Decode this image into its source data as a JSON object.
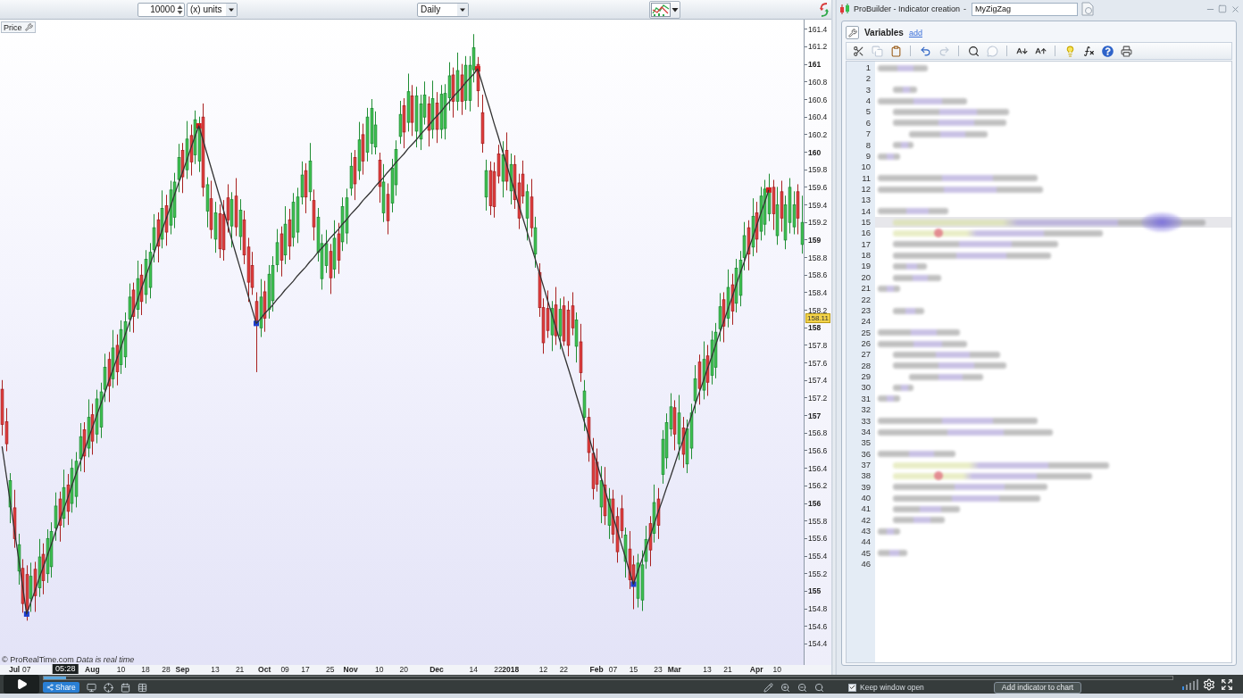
{
  "chart_window": {
    "toolbar": {
      "quantity": "10000",
      "unit": "(x) units",
      "timeframe": "Daily"
    },
    "chart": {
      "label": "Price",
      "footer": "© ProRealTime.com *Data is real time*",
      "chart_data": {
        "type": "candlestick",
        "ylim": [
          154.16,
          161.51
        ],
        "yticks": [
          {
            "value": 161.4,
            "label": "161.4"
          },
          {
            "value": 161.2,
            "label": "161.2"
          },
          {
            "value": 161,
            "label": "161"
          },
          {
            "value": 160.8,
            "label": "160.8"
          },
          {
            "value": 160.6,
            "label": "160.6"
          },
          {
            "value": 160.4,
            "label": "160.4"
          },
          {
            "value": 160.2,
            "label": "160.2"
          },
          {
            "value": 160,
            "label": "160"
          },
          {
            "value": 159.8,
            "label": "159.8"
          },
          {
            "value": 159.6,
            "label": "159.6"
          },
          {
            "value": 159.4,
            "label": "159.4"
          },
          {
            "value": 159.2,
            "label": "159.2"
          },
          {
            "value": 159,
            "label": "159"
          },
          {
            "value": 158.8,
            "label": "158.8"
          },
          {
            "value": 158.6,
            "label": "158.6"
          },
          {
            "value": 158.4,
            "label": "158.4"
          },
          {
            "value": 158.2,
            "label": "158.2"
          },
          {
            "value": 158,
            "label": "158"
          },
          {
            "value": 157.8,
            "label": "157.8"
          },
          {
            "value": 157.6,
            "label": "157.6"
          },
          {
            "value": 157.4,
            "label": "157.4"
          },
          {
            "value": 157.2,
            "label": "157.2"
          },
          {
            "value": 157,
            "label": "157"
          },
          {
            "value": 156.8,
            "label": "156.8"
          },
          {
            "value": 156.6,
            "label": "156.6"
          },
          {
            "value": 156.4,
            "label": "156.4"
          },
          {
            "value": 156.2,
            "label": "156.2"
          },
          {
            "value": 156,
            "label": "156"
          },
          {
            "value": 155.8,
            "label": "155.8"
          },
          {
            "value": 155.6,
            "label": "155.6"
          },
          {
            "value": 155.4,
            "label": "155.4"
          },
          {
            "value": 155.2,
            "label": "155.2"
          },
          {
            "value": 155,
            "label": "155"
          },
          {
            "value": 154.8,
            "label": "154.8"
          },
          {
            "value": 154.6,
            "label": "154.6"
          },
          {
            "value": 154.4,
            "label": "154.4"
          }
        ],
        "categories": [
          null,
          null,
          null,
          "Jul",
          null,
          null,
          "07",
          null,
          null,
          null,
          null,
          null,
          null,
          null,
          null,
          null,
          null,
          null,
          null,
          null,
          null,
          null,
          "Aug",
          null,
          null,
          null,
          null,
          null,
          null,
          "10",
          null,
          null,
          null,
          null,
          null,
          "18",
          null,
          null,
          null,
          null,
          "28",
          null,
          null,
          null,
          "Sep",
          null,
          null,
          null,
          null,
          null,
          null,
          null,
          "13",
          null,
          null,
          null,
          null,
          null,
          "21",
          null,
          null,
          null,
          null,
          null,
          "Oct",
          null,
          null,
          null,
          null,
          "09",
          null,
          null,
          null,
          null,
          "17",
          null,
          null,
          null,
          null,
          null,
          "25",
          null,
          null,
          null,
          null,
          "Nov",
          null,
          null,
          null,
          null,
          null,
          null,
          "10",
          null,
          null,
          null,
          null,
          null,
          "20",
          null,
          null,
          null,
          null,
          null,
          null,
          null,
          "Dec",
          null,
          null,
          null,
          null,
          null,
          null,
          null,
          null,
          "14",
          null,
          null,
          null,
          null,
          null,
          "22",
          null,
          null,
          "2018",
          null,
          null,
          null,
          null,
          null,
          null,
          null,
          "12",
          null,
          null,
          null,
          null,
          "22",
          null,
          null,
          null,
          null,
          null,
          null,
          null,
          "Feb",
          null,
          null,
          null,
          "07",
          null,
          null,
          null,
          null,
          "15",
          null,
          null,
          null,
          null,
          null,
          "23",
          null,
          null,
          null,
          "Mar",
          null,
          null,
          null,
          null,
          null,
          null,
          null,
          "13",
          null,
          null,
          null,
          null,
          "21",
          null,
          null,
          null,
          null,
          null,
          null,
          "Apr",
          null,
          null,
          null,
          null,
          "10",
          null,
          null,
          null,
          null,
          null,
          null
        ],
        "ohlc": [
          [
            157.3,
            157.4,
            156.78,
            156.9
          ],
          [
            156.93,
            157.08,
            156.6,
            156.68
          ],
          [
            155.96,
            156.34,
            155.78,
            156.26
          ],
          [
            155.95,
            156.15,
            155.5,
            155.6
          ],
          [
            155.23,
            155.65,
            155.08,
            155.53
          ],
          [
            155.26,
            155.36,
            154.76,
            154.86
          ],
          [
            155.19,
            155.29,
            154.67,
            154.79
          ],
          [
            154.92,
            155.32,
            154.77,
            155.17
          ],
          [
            155.25,
            155.33,
            154.77,
            154.95
          ],
          [
            155.04,
            155.59,
            154.94,
            155.39
          ],
          [
            155.42,
            155.54,
            154.97,
            155.12
          ],
          [
            155.2,
            155.7,
            155.1,
            155.6
          ],
          [
            155.28,
            155.78,
            155.16,
            155.68
          ],
          [
            155.72,
            156.12,
            155.58,
            155.97
          ],
          [
            156.05,
            156.13,
            155.57,
            155.75
          ],
          [
            155.83,
            156.38,
            155.73,
            156.18
          ],
          [
            156.21,
            156.33,
            155.76,
            155.91
          ],
          [
            156.0,
            156.5,
            155.9,
            156.4
          ],
          [
            156.08,
            156.58,
            155.96,
            156.48
          ],
          [
            156.51,
            156.91,
            156.37,
            156.76
          ],
          [
            156.84,
            156.92,
            156.36,
            156.54
          ],
          [
            156.63,
            157.18,
            156.53,
            156.98
          ],
          [
            157.01,
            157.13,
            156.56,
            156.71
          ],
          [
            156.79,
            157.29,
            156.69,
            157.19
          ],
          [
            156.87,
            157.37,
            156.75,
            157.27
          ],
          [
            157.3,
            157.7,
            157.16,
            157.55
          ],
          [
            157.64,
            157.72,
            157.16,
            157.34
          ],
          [
            157.42,
            157.97,
            157.32,
            157.77
          ],
          [
            157.8,
            157.92,
            157.35,
            157.5
          ],
          [
            157.58,
            158.08,
            157.48,
            157.98
          ],
          [
            157.67,
            158.17,
            157.55,
            158.07
          ],
          [
            158.1,
            158.5,
            157.96,
            158.35
          ],
          [
            158.43,
            158.51,
            157.95,
            158.13
          ],
          [
            158.21,
            158.76,
            158.11,
            158.56
          ],
          [
            158.6,
            158.72,
            158.15,
            158.3
          ],
          [
            158.38,
            158.88,
            158.28,
            158.78
          ],
          [
            158.46,
            158.96,
            158.34,
            158.86
          ],
          [
            158.89,
            159.29,
            158.75,
            159.14
          ],
          [
            159.23,
            159.31,
            158.75,
            158.93
          ],
          [
            159.01,
            159.56,
            158.91,
            159.36
          ],
          [
            159.39,
            159.51,
            158.94,
            159.09
          ],
          [
            159.17,
            159.67,
            159.07,
            159.57
          ],
          [
            159.26,
            159.76,
            159.14,
            159.66
          ],
          [
            159.69,
            160.09,
            159.55,
            159.94
          ],
          [
            160.02,
            160.1,
            159.54,
            159.72
          ],
          [
            159.8,
            160.35,
            159.7,
            160.15
          ],
          [
            160.19,
            160.31,
            159.74,
            159.89
          ],
          [
            159.97,
            160.47,
            159.87,
            160.37
          ],
          [
            159.9,
            160.4,
            159.78,
            160.3
          ],
          [
            160.4,
            160.55,
            159.5,
            159.6
          ],
          [
            159.33,
            159.71,
            159.15,
            159.63
          ],
          [
            159.47,
            159.67,
            159.02,
            159.12
          ],
          [
            159.01,
            159.43,
            158.86,
            159.31
          ],
          [
            159.3,
            159.4,
            158.8,
            158.9
          ],
          [
            159.29,
            159.45,
            158.77,
            158.89
          ],
          [
            159.48,
            159.63,
            159.09,
            159.23
          ],
          [
            159.16,
            159.54,
            158.92,
            159.46
          ],
          [
            159.5,
            159.7,
            159.05,
            159.15
          ],
          [
            159.04,
            159.46,
            158.89,
            159.34
          ],
          [
            159.23,
            159.33,
            158.73,
            158.83
          ],
          [
            158.92,
            159.02,
            158.3,
            158.52
          ],
          [
            158.71,
            158.86,
            158.38,
            158.46
          ],
          [
            158.3,
            158.4,
            157.5,
            158.05
          ],
          [
            158.0,
            158.55,
            157.9,
            158.35
          ],
          [
            158.41,
            158.53,
            157.96,
            158.11
          ],
          [
            158.21,
            158.71,
            158.11,
            158.61
          ],
          [
            158.31,
            158.81,
            158.19,
            158.71
          ],
          [
            158.72,
            159.12,
            158.64,
            158.97
          ],
          [
            159.07,
            159.15,
            158.59,
            158.77
          ],
          [
            158.83,
            159.38,
            158.73,
            159.18
          ],
          [
            159.23,
            159.35,
            158.78,
            158.93
          ],
          [
            159.03,
            159.53,
            158.93,
            159.43
          ],
          [
            159.09,
            159.59,
            158.97,
            159.49
          ],
          [
            159.49,
            159.89,
            159.41,
            159.74
          ],
          [
            159.79,
            159.87,
            159.31,
            159.49
          ],
          [
            159.55,
            160.1,
            159.45,
            159.9
          ],
          [
            159.45,
            159.57,
            159.0,
            159.15
          ],
          [
            158.86,
            159.36,
            158.76,
            159.26
          ],
          [
            158.56,
            159.06,
            158.44,
            158.96
          ],
          [
            158.71,
            159.11,
            158.63,
            158.96
          ],
          [
            158.87,
            158.95,
            158.39,
            158.57
          ],
          [
            158.67,
            159.22,
            158.57,
            159.02
          ],
          [
            159.07,
            159.19,
            158.62,
            158.77
          ],
          [
            158.98,
            159.48,
            158.88,
            159.38
          ],
          [
            159.08,
            159.58,
            158.96,
            159.48
          ],
          [
            159.59,
            159.99,
            159.51,
            159.84
          ],
          [
            159.94,
            160.02,
            159.46,
            159.64
          ],
          [
            159.79,
            160.34,
            159.69,
            160.14
          ],
          [
            160.2,
            160.32,
            159.75,
            159.9
          ],
          [
            160.0,
            160.5,
            159.9,
            160.4
          ],
          [
            160.1,
            160.6,
            159.98,
            160.5
          ],
          [
            160.06,
            160.46,
            159.98,
            160.31
          ],
          [
            159.91,
            159.99,
            159.43,
            159.61
          ],
          [
            159.31,
            159.86,
            159.21,
            159.66
          ],
          [
            159.52,
            159.64,
            159.07,
            159.22
          ],
          [
            159.42,
            159.92,
            159.32,
            159.82
          ],
          [
            159.63,
            160.13,
            159.51,
            160.03
          ],
          [
            160.18,
            160.58,
            160.1,
            160.43
          ],
          [
            160.53,
            160.61,
            160.05,
            160.23
          ],
          [
            160.34,
            160.89,
            160.24,
            160.69
          ],
          [
            160.64,
            160.76,
            160.19,
            160.34
          ],
          [
            160.24,
            160.74,
            160.06,
            160.64
          ],
          [
            160.15,
            160.65,
            160.03,
            160.55
          ],
          [
            160.4,
            160.8,
            160.32,
            160.65
          ],
          [
            160.55,
            160.63,
            160.07,
            160.25
          ],
          [
            160.26,
            160.81,
            160.16,
            160.61
          ],
          [
            160.56,
            160.68,
            160.11,
            160.26
          ],
          [
            160.26,
            160.76,
            160.16,
            160.66
          ],
          [
            160.27,
            160.77,
            160.15,
            160.67
          ],
          [
            160.62,
            161.02,
            160.48,
            160.87
          ],
          [
            160.88,
            160.96,
            160.4,
            160.58
          ],
          [
            160.58,
            161.13,
            160.48,
            160.93
          ],
          [
            160.88,
            161.0,
            160.43,
            160.58
          ],
          [
            160.59,
            161.09,
            160.49,
            160.99
          ],
          [
            160.59,
            161.09,
            160.47,
            160.99
          ],
          [
            160.94,
            161.34,
            160.8,
            161.19
          ],
          [
            161.0,
            161.08,
            160.52,
            160.7
          ],
          [
            160.45,
            160.65,
            160.0,
            160.1
          ],
          [
            159.49,
            159.91,
            159.34,
            159.79
          ],
          [
            159.79,
            159.89,
            159.29,
            159.39
          ],
          [
            159.78,
            159.88,
            159.26,
            159.38
          ],
          [
            159.98,
            160.08,
            159.65,
            159.73
          ],
          [
            159.67,
            160.12,
            159.49,
            159.97
          ],
          [
            160.02,
            160.22,
            159.57,
            159.67
          ],
          [
            159.56,
            159.98,
            159.41,
            159.86
          ],
          [
            159.86,
            159.96,
            159.36,
            159.46
          ],
          [
            159.65,
            159.75,
            159.13,
            159.25
          ],
          [
            159.75,
            159.9,
            159.42,
            159.5
          ],
          [
            159.25,
            159.63,
            159.0,
            159.55
          ],
          [
            159.49,
            159.69,
            159.04,
            159.14
          ],
          [
            158.84,
            159.26,
            158.69,
            159.14
          ],
          [
            158.63,
            158.73,
            158.13,
            158.23
          ],
          [
            158.23,
            158.33,
            157.71,
            157.83
          ],
          [
            158.22,
            158.42,
            157.89,
            157.97
          ],
          [
            157.92,
            158.3,
            157.74,
            158.22
          ],
          [
            158.26,
            158.46,
            157.81,
            157.91
          ],
          [
            157.91,
            158.33,
            157.76,
            158.21
          ],
          [
            158.25,
            158.35,
            157.8,
            157.85
          ],
          [
            158.2,
            158.3,
            157.68,
            157.8
          ],
          [
            158.25,
            158.4,
            157.92,
            158.0
          ],
          [
            157.79,
            158.17,
            157.61,
            158.09
          ],
          [
            157.84,
            158.04,
            157.39,
            157.49
          ],
          [
            156.98,
            157.4,
            156.83,
            157.28
          ],
          [
            156.98,
            157.08,
            156.48,
            156.58
          ],
          [
            156.57,
            156.74,
            156.05,
            156.17
          ],
          [
            156.47,
            156.62,
            156.14,
            156.22
          ],
          [
            155.96,
            156.42,
            155.78,
            156.26
          ],
          [
            156.21,
            156.41,
            155.76,
            155.86
          ],
          [
            155.75,
            156.17,
            155.6,
            156.05
          ],
          [
            156.05,
            156.15,
            155.55,
            155.65
          ],
          [
            155.85,
            155.95,
            155.33,
            155.45
          ],
          [
            155.94,
            156.09,
            155.61,
            155.69
          ],
          [
            155.34,
            155.72,
            155.16,
            155.64
          ],
          [
            155.48,
            155.68,
            155.03,
            155.13
          ],
          [
            155.3,
            155.4,
            154.8,
            155.08
          ],
          [
            154.92,
            155.42,
            154.82,
            155.32
          ],
          [
            154.9,
            155.46,
            154.78,
            155.3
          ],
          [
            155.34,
            155.74,
            155.26,
            155.59
          ],
          [
            155.77,
            155.85,
            155.29,
            155.47
          ],
          [
            155.66,
            156.21,
            155.56,
            156.01
          ],
          [
            156.05,
            156.17,
            155.6,
            155.75
          ],
          [
            156.33,
            156.83,
            156.23,
            156.73
          ],
          [
            156.52,
            157.02,
            156.4,
            156.92
          ],
          [
            156.85,
            157.25,
            156.77,
            157.1
          ],
          [
            157.09,
            157.17,
            156.61,
            156.79
          ],
          [
            156.68,
            157.23,
            156.5,
            157.03
          ],
          [
            156.86,
            156.98,
            156.41,
            156.56
          ],
          [
            156.45,
            156.95,
            156.35,
            156.85
          ],
          [
            156.63,
            157.13,
            156.51,
            157.03
          ],
          [
            157.17,
            157.57,
            157.03,
            157.42
          ],
          [
            157.61,
            157.69,
            157.13,
            157.31
          ],
          [
            157.29,
            157.84,
            157.19,
            157.64
          ],
          [
            157.68,
            157.8,
            157.23,
            157.38
          ],
          [
            157.46,
            157.96,
            157.36,
            157.86
          ],
          [
            157.55,
            158.05,
            157.43,
            157.95
          ],
          [
            157.99,
            158.39,
            157.85,
            158.24
          ],
          [
            158.32,
            158.4,
            157.84,
            158.02
          ],
          [
            158.11,
            158.66,
            158.01,
            158.46
          ],
          [
            158.49,
            158.61,
            158.04,
            158.19
          ],
          [
            158.28,
            158.78,
            158.18,
            158.68
          ],
          [
            158.37,
            158.87,
            158.25,
            158.77
          ],
          [
            158.8,
            159.2,
            158.66,
            159.05
          ],
          [
            159.14,
            159.22,
            158.66,
            158.84
          ],
          [
            158.92,
            159.47,
            158.82,
            159.27
          ],
          [
            159.31,
            159.43,
            158.86,
            159.01
          ],
          [
            159.1,
            159.6,
            159.0,
            159.5
          ],
          [
            159.18,
            159.68,
            159.06,
            159.58
          ],
          [
            159.3,
            159.75,
            159.22,
            159.57
          ],
          [
            159.6,
            159.68,
            159.12,
            159.3
          ],
          [
            159.05,
            159.6,
            158.95,
            159.4
          ],
          [
            159.55,
            159.67,
            159.1,
            159.25
          ],
          [
            159.0,
            159.5,
            158.9,
            159.4
          ],
          [
            159.2,
            159.7,
            159.08,
            159.6
          ],
          [
            159.15,
            159.55,
            159.07,
            159.4
          ],
          [
            159.55,
            159.63,
            159.07,
            159.25
          ],
          [
            158.95,
            159.5,
            158.85,
            159.2
          ]
        ],
        "series": [
          {
            "type": "line",
            "color": "#333333",
            "values": [
              156.65,
              156.33,
              156.01,
              155.7,
              155.38,
              155.06,
              154.74,
              154.87,
              155.0,
              155.14,
              155.27,
              155.4,
              155.53,
              155.67,
              155.8,
              155.93,
              156.06,
              156.2,
              156.33,
              156.46,
              156.59,
              156.73,
              156.86,
              156.99,
              157.12,
              157.25,
              157.39,
              157.52,
              157.65,
              157.78,
              157.92,
              158.05,
              158.18,
              158.31,
              158.45,
              158.58,
              158.71,
              158.84,
              158.98,
              159.11,
              159.24,
              159.37,
              159.51,
              159.64,
              159.77,
              159.9,
              160.04,
              160.17,
              160.3,
              160.14,
              159.98,
              159.82,
              159.66,
              159.5,
              159.34,
              159.18,
              159.01,
              158.85,
              158.69,
              158.53,
              158.37,
              158.21,
              158.05,
              158.1,
              158.16,
              158.21,
              158.26,
              158.32,
              158.37,
              158.43,
              158.48,
              158.53,
              158.59,
              158.64,
              158.69,
              158.75,
              158.8,
              158.86,
              158.91,
              158.96,
              159.02,
              159.07,
              159.12,
              159.18,
              159.23,
              159.29,
              159.34,
              159.39,
              159.45,
              159.5,
              159.55,
              159.61,
              159.66,
              159.71,
              159.77,
              159.82,
              159.88,
              159.93,
              159.98,
              160.04,
              160.09,
              160.14,
              160.2,
              160.25,
              160.3,
              160.36,
              160.41,
              160.46,
              160.52,
              160.57,
              160.63,
              160.68,
              160.73,
              160.79,
              160.84,
              160.89,
              160.95,
              160.8,
              160.64,
              160.49,
              160.33,
              160.18,
              160.02,
              159.87,
              159.71,
              159.56,
              159.4,
              159.25,
              159.1,
              158.94,
              158.79,
              158.63,
              158.48,
              158.32,
              158.17,
              158.01,
              157.86,
              157.7,
              157.55,
              157.4,
              157.24,
              157.09,
              156.93,
              156.78,
              156.62,
              156.47,
              156.31,
              156.16,
              156.0,
              155.85,
              155.7,
              155.54,
              155.39,
              155.23,
              155.08,
              155.22,
              155.35,
              155.49,
              155.62,
              155.76,
              155.9,
              156.03,
              156.17,
              156.3,
              156.44,
              156.58,
              156.71,
              156.85,
              156.98,
              157.12,
              157.26,
              157.39,
              157.53,
              157.66,
              157.8,
              157.94,
              158.07,
              158.21,
              158.34,
              158.48,
              158.62,
              158.75,
              158.89,
              159.02,
              159.16,
              159.3,
              159.43,
              159.57,
              null,
              null,
              null,
              null,
              null,
              null,
              null,
              null
            ]
          }
        ],
        "annotations": [
          {
            "y": 158.11,
            "text": "158.11"
          }
        ]
      }
    },
    "bottom_toolbar": {
      "share": "Share"
    }
  },
  "probuilder": {
    "title": "ProBuilder - Indicator creation",
    "separator": "-",
    "name": "MyZigZag",
    "variables": {
      "label": "Variables",
      "link": "add"
    },
    "toolbar": [
      [
        {
          "disabled": false
        },
        {
          "disabled": true
        },
        {
          "disabled": false
        }
      ],
      [
        {
          "disabled": false
        },
        {
          "disabled": true
        }
      ],
      [
        {
          "disabled": false
        },
        {
          "disabled": true
        }
      ],
      [
        {
          "disabled": false
        },
        {
          "disabled": false
        }
      ],
      [
        {
          "disabled": false
        },
        {
          "disabled": false
        },
        {
          "disabled": false
        },
        {
          "disabled": false
        }
      ]
    ],
    "lines": [
      {
        "number": "1",
        "blurred": true,
        "selected": false,
        "marker": false
      },
      {
        "number": "2",
        "blurred": false,
        "selected": false,
        "marker": false
      },
      {
        "number": "3",
        "blurred": true,
        "selected": false,
        "marker": false
      },
      {
        "number": "4",
        "blurred": true,
        "selected": false,
        "marker": false
      },
      {
        "number": "5",
        "blurred": true,
        "selected": false,
        "marker": false
      },
      {
        "number": "6",
        "blurred": true,
        "selected": false,
        "marker": false
      },
      {
        "number": "7",
        "blurred": true,
        "selected": false,
        "marker": false
      },
      {
        "number": "8",
        "blurred": true,
        "selected": false,
        "marker": false
      },
      {
        "number": "9",
        "blurred": true,
        "selected": false,
        "marker": false
      },
      {
        "number": "10",
        "blurred": false,
        "selected": false,
        "marker": false
      },
      {
        "number": "11",
        "blurred": true,
        "selected": false,
        "marker": false
      },
      {
        "number": "12",
        "blurred": true,
        "selected": false,
        "marker": false
      },
      {
        "number": "13",
        "blurred": false,
        "selected": false,
        "marker": false
      },
      {
        "number": "14",
        "blurred": true,
        "selected": false,
        "marker": false
      },
      {
        "number": "15",
        "blurred": true,
        "selected": true,
        "marker": false
      },
      {
        "number": "16",
        "blurred": true,
        "selected": false,
        "marker": true
      },
      {
        "number": "17",
        "blurred": true,
        "selected": false,
        "marker": false
      },
      {
        "number": "18",
        "blurred": true,
        "selected": false,
        "marker": false
      },
      {
        "number": "19",
        "blurred": true,
        "selected": false,
        "marker": false
      },
      {
        "number": "20",
        "blurred": true,
        "selected": false,
        "marker": false
      },
      {
        "number": "21",
        "blurred": true,
        "selected": false,
        "marker": false
      },
      {
        "number": "22",
        "blurred": false,
        "selected": false,
        "marker": false
      },
      {
        "number": "23",
        "blurred": true,
        "selected": false,
        "marker": false
      },
      {
        "number": "24",
        "blurred": false,
        "selected": false,
        "marker": false
      },
      {
        "number": "25",
        "blurred": true,
        "selected": false,
        "marker": false
      },
      {
        "number": "26",
        "blurred": true,
        "selected": false,
        "marker": false
      },
      {
        "number": "27",
        "blurred": true,
        "selected": false,
        "marker": false
      },
      {
        "number": "28",
        "blurred": true,
        "selected": false,
        "marker": false
      },
      {
        "number": "29",
        "blurred": true,
        "selected": false,
        "marker": false
      },
      {
        "number": "30",
        "blurred": true,
        "selected": false,
        "marker": false
      },
      {
        "number": "31",
        "blurred": true,
        "selected": false,
        "marker": false
      },
      {
        "number": "32",
        "blurred": false,
        "selected": false,
        "marker": false
      },
      {
        "number": "33",
        "blurred": true,
        "selected": false,
        "marker": false
      },
      {
        "number": "34",
        "blurred": true,
        "selected": false,
        "marker": false
      },
      {
        "number": "35",
        "blurred": false,
        "selected": false,
        "marker": false
      },
      {
        "number": "36",
        "blurred": true,
        "selected": false,
        "marker": false
      },
      {
        "number": "37",
        "blurred": true,
        "selected": false,
        "marker": false
      },
      {
        "number": "38",
        "blurred": true,
        "selected": false,
        "marker": true
      },
      {
        "number": "39",
        "blurred": true,
        "selected": false,
        "marker": false
      },
      {
        "number": "40",
        "blurred": true,
        "selected": false,
        "marker": false
      },
      {
        "number": "41",
        "blurred": true,
        "selected": false,
        "marker": false
      },
      {
        "number": "42",
        "blurred": true,
        "selected": false,
        "marker": false
      },
      {
        "number": "43",
        "blurred": true,
        "selected": false,
        "marker": false
      },
      {
        "number": "44",
        "blurred": false,
        "selected": false,
        "marker": false
      },
      {
        "number": "45",
        "blurred": true,
        "selected": false,
        "marker": false
      },
      {
        "number": "46",
        "blurred": false,
        "selected": false,
        "marker": false
      }
    ],
    "keep_open": {
      "label": "Keep window open",
      "checked": true
    },
    "add_button": "Add indicator to chart"
  },
  "video_player": {
    "time": "05:28",
    "progress": {
      "level": 0.02
    }
  }
}
